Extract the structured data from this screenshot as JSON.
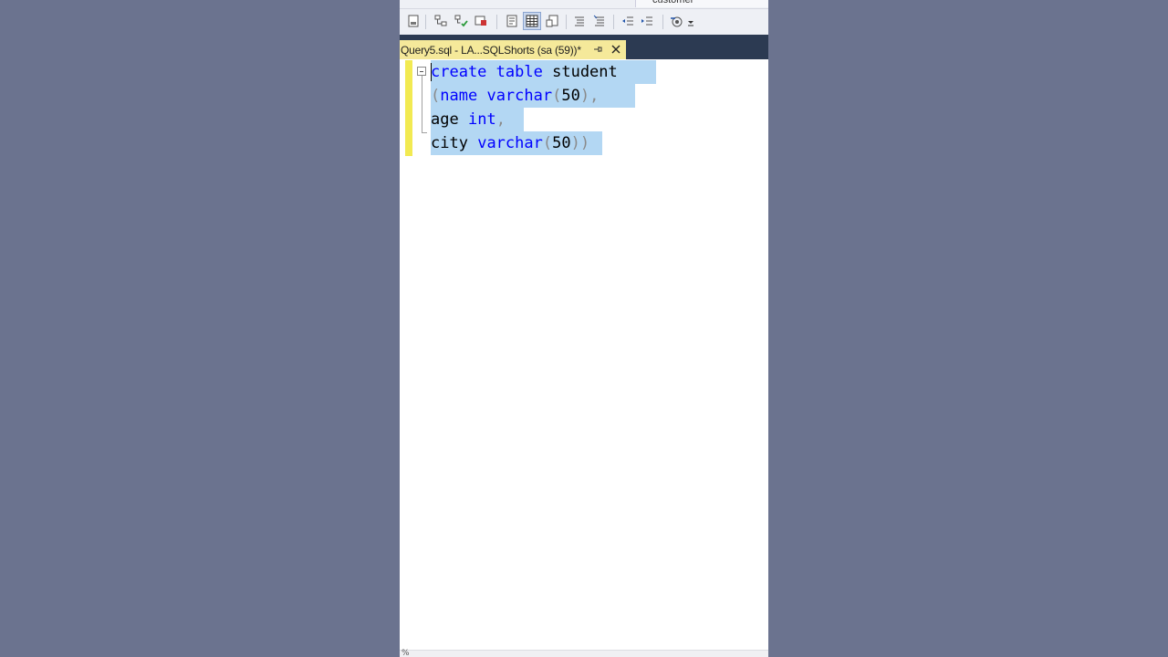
{
  "toolbar": {
    "search_text": "customer",
    "icons": [
      "parse-icon",
      "display-plan-icon",
      "include-plan-icon",
      "live-stats-icon",
      "results-text-icon",
      "results-grid-icon",
      "results-file-icon",
      "comment-icon",
      "uncomment-icon",
      "decrease-indent-icon",
      "increase-indent-icon",
      "specify-values-icon",
      "more-icon"
    ]
  },
  "tab": {
    "title": "Query5.sql - LA...SQLShorts (sa (59))*"
  },
  "editor": {
    "lines": [
      {
        "parts": [
          "create",
          " ",
          "table",
          " ",
          "student"
        ]
      },
      {
        "parts": [
          "(",
          "name",
          " ",
          "varchar",
          "(",
          "50",
          ")",
          ","
        ]
      },
      {
        "parts": [
          "age",
          " ",
          "int",
          ","
        ]
      },
      {
        "parts": [
          "city",
          " ",
          "varchar",
          "(",
          "50",
          ")",
          ")"
        ]
      }
    ],
    "selection_color": "#b3d7f3",
    "keyword_color": "#0000ff"
  },
  "status": {
    "zoom": "%"
  }
}
